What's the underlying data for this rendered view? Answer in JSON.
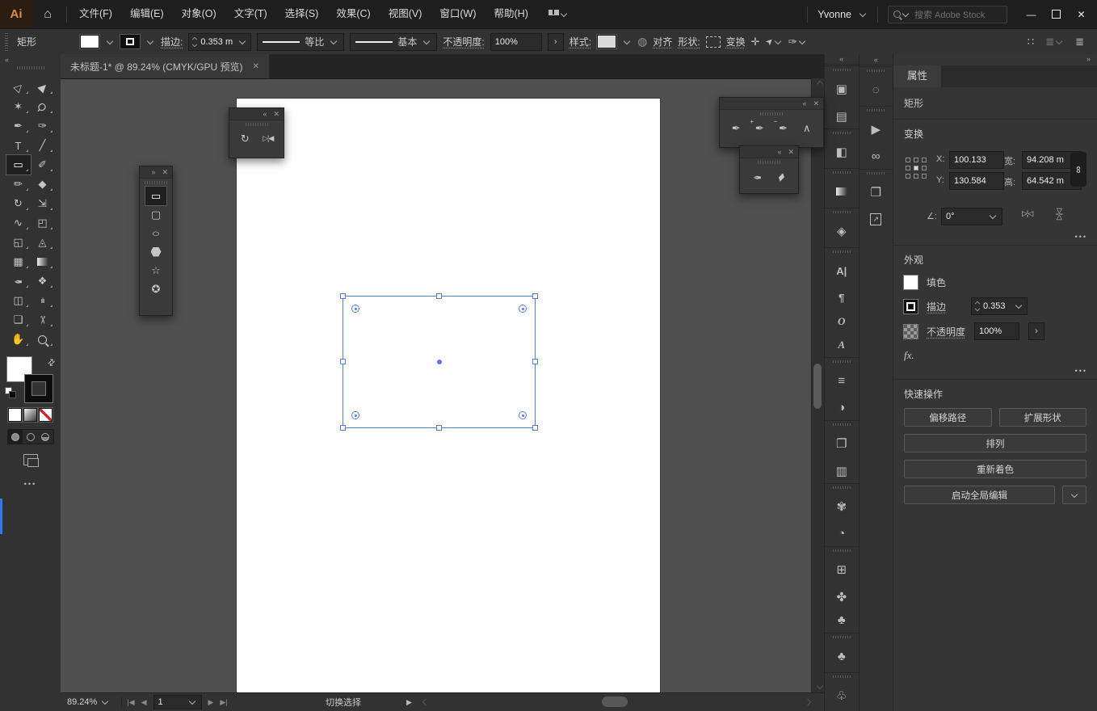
{
  "colors": {
    "accent_selection": "#4f80e1",
    "panel_bg": "#333333",
    "titlebar_bg": "#1e1e1e",
    "canvas_bg": "#4f4f4f",
    "artboard": "#ffffff",
    "logo_orange": "#d98d4e",
    "accent_bar_blue": "#3178f6"
  },
  "titlebar": {
    "logo": "Ai",
    "menus": [
      {
        "name": "menu-file",
        "label": "文件(F)"
      },
      {
        "name": "menu-edit",
        "label": "编辑(E)"
      },
      {
        "name": "menu-object",
        "label": "对象(O)"
      },
      {
        "name": "menu-type",
        "label": "文字(T)"
      },
      {
        "name": "menu-select",
        "label": "选择(S)"
      },
      {
        "name": "menu-effect",
        "label": "效果(C)"
      },
      {
        "name": "menu-view",
        "label": "视图(V)"
      },
      {
        "name": "menu-window",
        "label": "窗口(W)"
      },
      {
        "name": "menu-help",
        "label": "帮助(H)"
      }
    ],
    "user": "Yvonne",
    "search_placeholder": "搜索 Adobe Stock"
  },
  "options": {
    "tool_name": "矩形",
    "stroke_label": "描边:",
    "stroke_value": "0.353 m",
    "profile_value": "等比",
    "brush_value": "基本",
    "opacity_label": "不透明度:",
    "opacity_value": "100%",
    "style_label": "样式:",
    "align_label": "对齐",
    "shape_label": "形状:",
    "transform_label": "变换"
  },
  "doc_tab": {
    "title": "未标题-1* @ 89.24% (CMYK/GPU 预览)"
  },
  "tools": [
    {
      "name": "direct-selection-tool",
      "glyph": "▷",
      "cls": "rot315"
    },
    {
      "name": "selection-tool",
      "glyph": "▶",
      "cls": "rot315"
    },
    {
      "name": "magic-wand-tool",
      "glyph": "✶",
      "cls": ""
    },
    {
      "name": "lasso-tool",
      "glyph": "Ϙ",
      "cls": "rot45"
    },
    {
      "name": "pen-tool",
      "glyph": "✒",
      "cls": ""
    },
    {
      "name": "curvature-tool",
      "glyph": "✑",
      "cls": ""
    },
    {
      "name": "type-tool",
      "glyph": "T",
      "cls": ""
    },
    {
      "name": "line-segment-tool",
      "glyph": "╱",
      "cls": ""
    },
    {
      "name": "rectangle-tool",
      "glyph": "▭",
      "cls": "selected"
    },
    {
      "name": "paintbrush-tool",
      "glyph": "✐",
      "cls": ""
    },
    {
      "name": "shaper-tool",
      "glyph": "✏",
      "cls": ""
    },
    {
      "name": "eraser-tool",
      "glyph": "◆",
      "cls": ""
    },
    {
      "name": "rotate-tool",
      "glyph": "↻",
      "cls": ""
    },
    {
      "name": "scale-tool",
      "glyph": "⇲",
      "cls": ""
    },
    {
      "name": "width-tool",
      "glyph": "∿",
      "cls": ""
    },
    {
      "name": "free-transform-tool",
      "glyph": "◰",
      "cls": ""
    },
    {
      "name": "shape-builder-tool",
      "glyph": "◱",
      "cls": ""
    },
    {
      "name": "perspective-grid-tool",
      "glyph": "◬",
      "cls": ""
    },
    {
      "name": "mesh-tool",
      "glyph": "▦",
      "cls": ""
    },
    {
      "name": "gradient-tool",
      "glyph": "",
      "cls": "gradbox"
    },
    {
      "name": "eyedropper-tool",
      "glyph": "✒",
      "cls": "rot180"
    },
    {
      "name": "blend-tool",
      "glyph": "❖",
      "cls": ""
    },
    {
      "name": "symbol-sprayer-tool",
      "glyph": "◫",
      "cls": ""
    },
    {
      "name": "column-graph-tool",
      "glyph": "ılı",
      "cls": "small"
    },
    {
      "name": "artboard-tool",
      "glyph": "❏",
      "cls": ""
    },
    {
      "name": "slice-tool",
      "glyph": "✂",
      "cls": "rot90"
    },
    {
      "name": "hand-tool",
      "glyph": "✋",
      "cls": ""
    },
    {
      "name": "zoom-tool",
      "glyph": "",
      "cls": "magshape"
    }
  ],
  "shape_tools": [
    {
      "name": "rectangle-tool",
      "glyph": "▭",
      "cls": "selected"
    },
    {
      "name": "rounded-rectangle-tool",
      "glyph": "▢",
      "cls": ""
    },
    {
      "name": "ellipse-tool",
      "glyph": "○",
      "cls": "widex"
    },
    {
      "name": "polygon-tool",
      "glyph": "",
      "cls": "hexshape"
    },
    {
      "name": "star-tool",
      "glyph": "☆",
      "cls": ""
    },
    {
      "name": "flare-tool",
      "glyph": "✪",
      "cls": ""
    }
  ],
  "float_rotate": {
    "tools": [
      {
        "name": "rotate-tool",
        "glyph": "↻",
        "cls": "",
        "badge": ""
      },
      {
        "name": "reflect-tool",
        "glyph": "▷¦◀",
        "cls": "small",
        "badge": ""
      }
    ]
  },
  "float_pen": {
    "tools": [
      {
        "name": "pen-tool",
        "glyph": "✒",
        "cls": "",
        "badge": ""
      },
      {
        "name": "add-anchor-point-tool",
        "glyph": "✒",
        "cls": "",
        "badge": "+"
      },
      {
        "name": "delete-anchor-point-tool",
        "glyph": "✒",
        "cls": "",
        "badge": "−"
      },
      {
        "name": "anchor-point-tool",
        "glyph": "∧",
        "cls": "thin",
        "badge": ""
      }
    ]
  },
  "float_eyedrop": {
    "tools": [
      {
        "name": "eyedropper-tool",
        "glyph": "✒",
        "cls": "rot180",
        "badge": ""
      },
      {
        "name": "measure-tool",
        "glyph": "▰",
        "cls": "rot315",
        "badge": ""
      }
    ]
  },
  "dock_col1": [
    {
      "name": "transform-panel-icon",
      "glyph": "▣",
      "cls": "grp"
    },
    {
      "name": "align-panel-icon",
      "glyph": "▤",
      "cls": ""
    },
    {
      "name": "pathfinder-panel-icon",
      "glyph": "◧",
      "cls": "grp"
    },
    {
      "name": "gradient-panel-icon",
      "glyph": "",
      "cls": "grp gradbox"
    },
    {
      "name": "layers-panel-icon",
      "glyph": "◈",
      "cls": "grp"
    },
    {
      "name": "character-panel-icon",
      "glyph": "A|",
      "cls": "grp text"
    },
    {
      "name": "paragraph-panel-icon",
      "glyph": "¶",
      "cls": "text"
    },
    {
      "name": "opentype-panel-icon",
      "glyph": "O",
      "cls": "text serifit"
    },
    {
      "name": "glyphs-panel-icon",
      "glyph": "A",
      "cls": "text serifit"
    },
    {
      "name": "stroke-panel-icon",
      "glyph": "≡",
      "cls": "grp"
    },
    {
      "name": "transparency-panel-icon",
      "glyph": "◑",
      "cls": ""
    },
    {
      "name": "artboards-panel-icon",
      "glyph": "❐",
      "cls": "grp"
    },
    {
      "name": "variables-panel-icon",
      "glyph": "▥",
      "cls": ""
    },
    {
      "name": "color-panel-icon",
      "glyph": "✾",
      "cls": "grp"
    },
    {
      "name": "color-guide-panel-icon",
      "glyph": "◔",
      "cls": ""
    },
    {
      "name": "swatches-panel-icon",
      "glyph": "⊞",
      "cls": "grp"
    },
    {
      "name": "brushes-panel-icon",
      "glyph": "✤",
      "cls": ""
    },
    {
      "name": "symbols-panel-icon",
      "glyph": "♣",
      "cls": ""
    },
    {
      "name": "libraries-panel-icon",
      "glyph": "♣",
      "cls": "grp push1"
    },
    {
      "name": "graphic-styles-panel-icon",
      "glyph": "♧",
      "cls": "grp push2"
    }
  ],
  "dock_col2": [
    {
      "name": "color-panel-icon",
      "glyph": "◌",
      "cls": "grp"
    },
    {
      "name": "actions-panel-icon",
      "glyph": "▶",
      "cls": "grp"
    },
    {
      "name": "links-panel-icon",
      "glyph": "∞",
      "cls": ""
    },
    {
      "name": "artboards-panel-icon",
      "glyph": "❐",
      "cls": "grp"
    },
    {
      "name": "asset-export-panel-icon",
      "glyph": "↗",
      "cls": "boxed"
    }
  ],
  "properties": {
    "tab": "属性",
    "object_type": "矩形",
    "transform": {
      "title": "变换",
      "x_label": "X:",
      "x_value": "100.133",
      "y_label": "Y:",
      "y_value": "130.584",
      "w_label": "宽:",
      "w_value": "94.208 m",
      "h_label": "高:",
      "h_value": "64.542 m",
      "angle_label": "∠:",
      "angle_value": "0°"
    },
    "appearance": {
      "title": "外观",
      "fill_label": "填色",
      "stroke_label": "描边",
      "stroke_value": "0.353",
      "opacity_label": "不透明度",
      "opacity_value": "100%"
    },
    "quick_actions": {
      "title": "快速操作",
      "buttons": [
        "偏移路径",
        "扩展形状",
        "排列",
        "重新着色",
        "启动全局编辑"
      ]
    }
  },
  "statusbar": {
    "zoom": "89.24%",
    "artboard_number": "1",
    "status_text": "切换选择"
  },
  "icons": {
    "home": "⌂",
    "minimize": "—",
    "close": "✕",
    "collapse": "«",
    "expand": "»",
    "link_chain": "∞",
    "flip_h": "▷¦◁",
    "fx": "fx.",
    "more": "•••",
    "globe": "◍",
    "angle_right": "›",
    "play": "▶",
    "nav_first": "|◀",
    "nav_prev": "◀",
    "nav_next": "▶",
    "nav_last": "▶|",
    "pointer": "➤",
    "move": "✛",
    "brush": "✑",
    "dots_grid": "∷",
    "list": "≣",
    "swap": "⇄"
  }
}
